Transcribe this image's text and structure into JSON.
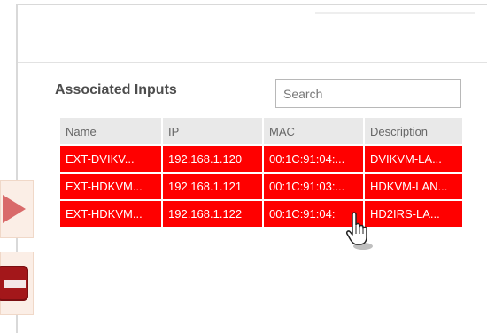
{
  "section": {
    "title": "Associated Inputs"
  },
  "search": {
    "placeholder": "Search"
  },
  "table": {
    "columns": [
      "Name",
      "IP",
      "MAC",
      "Description"
    ],
    "rows": [
      {
        "name": "EXT-DVIKV...",
        "ip": "192.168.1.120",
        "mac": "00:1C:91:04:...",
        "description": "DVIKVM-LA..."
      },
      {
        "name": "EXT-HDKVM...",
        "ip": "192.168.1.121",
        "mac": "00:1C:91:03:...",
        "description": "HDKVM-LAN..."
      },
      {
        "name": "EXT-HDKVM...",
        "ip": "192.168.1.122",
        "mac": "00:1C:91:04:",
        "description": "HD2IRS-LA..."
      }
    ],
    "row_color": "#ff0000",
    "header_color": "#e9e9e9"
  },
  "side_controls": {
    "play_icon": "play-icon",
    "stop_icon": "stop-icon"
  },
  "cursor_icon": "hand-pointer-icon"
}
